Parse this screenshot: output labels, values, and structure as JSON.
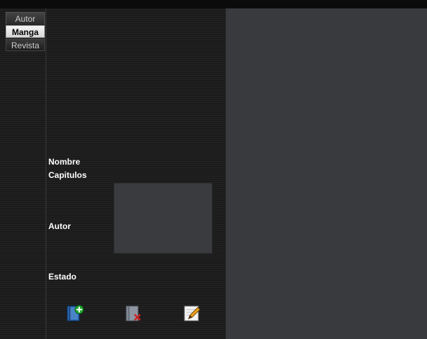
{
  "tabs": [
    {
      "label": "Autor"
    },
    {
      "label": "Manga"
    },
    {
      "label": "Revista"
    }
  ],
  "form": {
    "nombre_label": "Nombre",
    "capitulos_label": "Capitulos",
    "autor_label": "Autor",
    "estado_label": "Estado"
  },
  "actions": {
    "add_icon": "book-add-icon",
    "delete_icon": "book-delete-icon",
    "edit_icon": "pencil-edit-icon"
  },
  "colors": {
    "accent_add": "#22aa33",
    "accent_delete": "#cc2222",
    "edit_pencil": "#e8a020"
  }
}
